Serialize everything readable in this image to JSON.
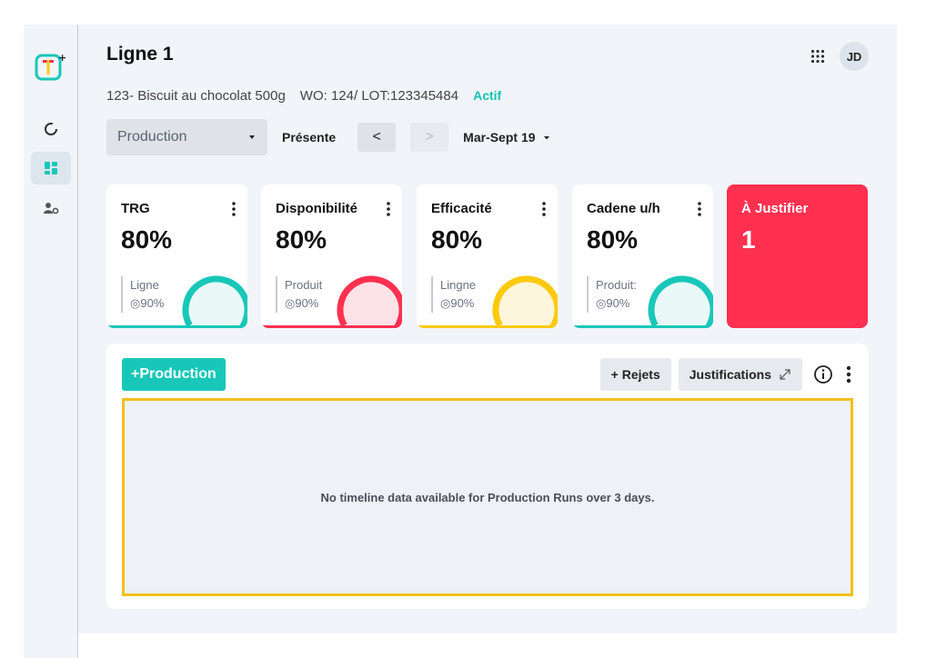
{
  "header": {
    "title": "Ligne 1",
    "product": "123- Biscuit au chocolat 500g",
    "wo_lot": "WO: 124/ LOT:123345484",
    "status": "Actif",
    "avatar_initials": "JD"
  },
  "controls": {
    "view_select": "Production",
    "mode_label": "Présente",
    "prev_label": "<",
    "next_label": ">",
    "date_range": "Mar-Sept 19"
  },
  "cards": [
    {
      "label": "TRG",
      "value": "80%",
      "foot_label": "Ligne",
      "target": "90%",
      "color": "#18c7b8",
      "fill": "#eaf8f7",
      "level": 0.8
    },
    {
      "label": "Disponibilité",
      "value": "80%",
      "foot_label": "Produit",
      "target": "90%",
      "color": "#ff3050",
      "fill": "#fde3e7",
      "level": 0.8
    },
    {
      "label": "Efficacité",
      "value": "80%",
      "foot_label": "Lingne",
      "target": "90%",
      "color": "#fcca0d",
      "fill": "#fdf6dc",
      "level": 0.8
    },
    {
      "label": "Cadene u/h",
      "value": "80%",
      "foot_label": "Produit:",
      "target": "90%",
      "color": "#18c7b8",
      "fill": "#eaf8f7",
      "level": 0.8
    },
    {
      "label": "À Justifier",
      "value": "1",
      "color": "#ff3050"
    }
  ],
  "panel": {
    "add_production": "+Production",
    "rejects": "+ Rejets",
    "justifications": "Justifications",
    "empty_message": "No timeline data available for Production Runs over 3 days."
  },
  "icons": {
    "logo": "app-logo-icon",
    "dashboard": "donut-chart-icon",
    "grid": "grid-icon",
    "user_settings": "user-gear-icon",
    "apps": "apps-dots-icon",
    "info": "info-icon",
    "expand": "expand-icon",
    "kebab": "kebab-icon",
    "target": "target-icon"
  }
}
